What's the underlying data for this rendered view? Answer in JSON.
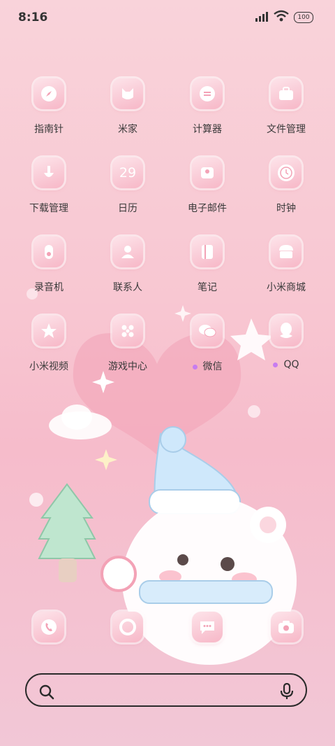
{
  "status": {
    "time": "8:16",
    "battery": "100"
  },
  "apps": [
    {
      "label": "指南针",
      "icon": "compass-icon"
    },
    {
      "label": "米家",
      "icon": "mijia-icon"
    },
    {
      "label": "计算器",
      "icon": "calculator-icon"
    },
    {
      "label": "文件管理",
      "icon": "briefcase-icon"
    },
    {
      "label": "下载管理",
      "icon": "download-icon"
    },
    {
      "label": "日历",
      "icon": "calendar-icon",
      "icon_text": "29"
    },
    {
      "label": "电子邮件",
      "icon": "mail-icon"
    },
    {
      "label": "时钟",
      "icon": "clock-icon"
    },
    {
      "label": "录音机",
      "icon": "recorder-icon"
    },
    {
      "label": "联系人",
      "icon": "contacts-icon"
    },
    {
      "label": "笔记",
      "icon": "notes-icon"
    },
    {
      "label": "小米商城",
      "icon": "store-icon"
    },
    {
      "label": "小米视频",
      "icon": "video-icon"
    },
    {
      "label": "游戏中心",
      "icon": "game-center-icon"
    },
    {
      "label": "微信",
      "icon": "wechat-icon",
      "badge": true
    },
    {
      "label": "QQ",
      "icon": "qq-icon",
      "badge": true
    }
  ],
  "dock": [
    {
      "icon": "phone-icon"
    },
    {
      "icon": "browser-icon"
    },
    {
      "icon": "messages-icon"
    },
    {
      "icon": "camera-icon"
    }
  ],
  "search": {
    "left_icon": "search-icon",
    "right_icon": "microphone-icon"
  },
  "colors": {
    "accent": "#f7b7c7",
    "badge": "#c77cf0"
  }
}
